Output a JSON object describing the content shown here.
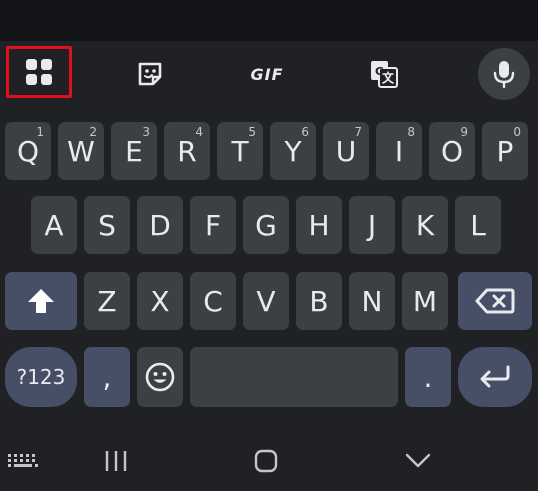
{
  "toolbar": {
    "gif_label": "GIF",
    "icons": [
      "apps-grid-icon",
      "sticker-icon",
      "gif-icon",
      "translate-icon",
      "microphone-icon"
    ]
  },
  "keyboard": {
    "row1": [
      {
        "label": "Q",
        "hint": "1"
      },
      {
        "label": "W",
        "hint": "2"
      },
      {
        "label": "E",
        "hint": "3"
      },
      {
        "label": "R",
        "hint": "4"
      },
      {
        "label": "T",
        "hint": "5"
      },
      {
        "label": "Y",
        "hint": "6"
      },
      {
        "label": "U",
        "hint": "7"
      },
      {
        "label": "I",
        "hint": "8"
      },
      {
        "label": "O",
        "hint": "9"
      },
      {
        "label": "P",
        "hint": "0"
      }
    ],
    "row2": [
      "A",
      "S",
      "D",
      "F",
      "G",
      "H",
      "J",
      "K",
      "L"
    ],
    "row3": [
      "Z",
      "X",
      "C",
      "V",
      "B",
      "N",
      "M"
    ],
    "symbols_label": "?123",
    "comma_label": ",",
    "period_label": ".",
    "space_label": ""
  },
  "colors": {
    "background": "#202124",
    "key": "#3c4043",
    "accent_key": "#474f66",
    "highlight": "#e0101d"
  }
}
